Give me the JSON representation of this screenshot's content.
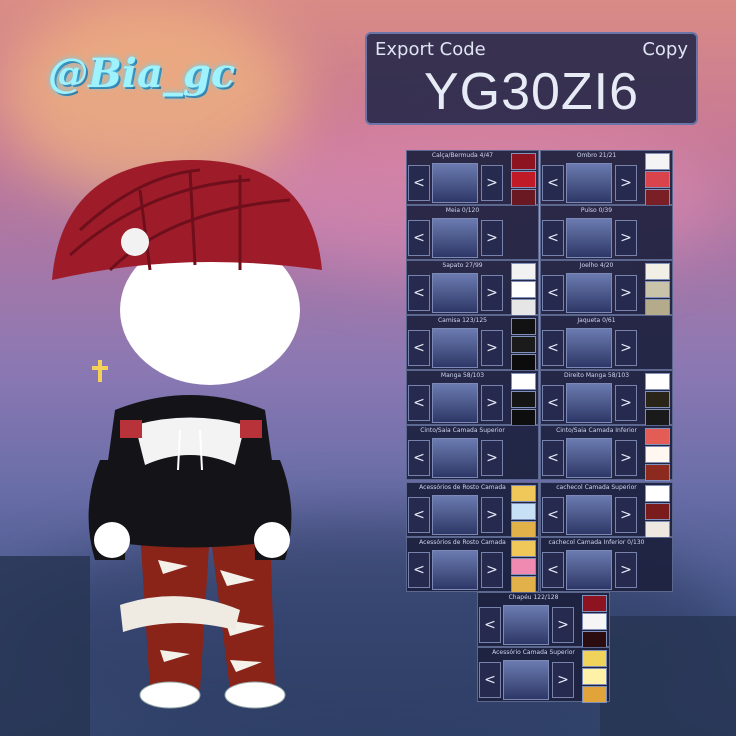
{
  "watermark": "@Bia_gc",
  "export_panel": {
    "title": "Export Code",
    "copy_label": "Copy",
    "code": "YG30ZI6"
  },
  "slots": [
    {
      "label": "Calça/Bermuda 4/47",
      "swatches": [
        "#8d1320",
        "#c01a26",
        "#6a1822"
      ]
    },
    {
      "label": "Ombro 21/21",
      "swatches": [
        "#f4f4f4",
        "#d9434b",
        "#7a1f26"
      ]
    },
    {
      "label": "Meia 0/120",
      "swatches": []
    },
    {
      "label": "Pulso 0/39",
      "swatches": []
    },
    {
      "label": "Sapato 27/99",
      "swatches": [
        "#f2f2f2",
        "#ffffff",
        "#e6e6e6"
      ]
    },
    {
      "label": "Joelho 4/20",
      "swatches": [
        "#f1efe6",
        "#c9c4a9",
        "#b3ab8a"
      ]
    },
    {
      "label": "Camisa 123/125",
      "swatches": [
        "#121212",
        "#1b1b1b",
        "#0c0c0c"
      ]
    },
    {
      "label": "Jaqueta 0/61",
      "swatches": []
    },
    {
      "label": "Manga 58/103",
      "swatches": [
        "#ffffff",
        "#151515",
        "#0e0e0e"
      ]
    },
    {
      "label": "Direito Manga 58/103",
      "swatches": [
        "#ffffff",
        "#2b2418",
        "#1a1a1a"
      ]
    },
    {
      "label": "Cinto/Saia Camada Superior",
      "swatches": []
    },
    {
      "label": "Cinto/Saia Camada Inferior",
      "swatches": [
        "#e35c55",
        "#fff7f0",
        "#8d2a20"
      ]
    },
    {
      "label": "Acessórios de Rosto Camada",
      "swatches": [
        "#f0c85a",
        "#c8e0f6",
        "#e3b14a"
      ]
    },
    {
      "label": "cachecol Camada Superior",
      "swatches": [
        "#ffffff",
        "#7a1c1c",
        "#efe8e0"
      ]
    },
    {
      "label": "Acessórios de Rosto Camada",
      "swatches": [
        "#f0c85a",
        "#f08ab0",
        "#e3b14a"
      ]
    },
    {
      "label": "cachecol Camada Inferior 0/130",
      "swatches": []
    },
    {
      "label": "Chapéu 122/128",
      "swatches": [
        "#8d1320",
        "#f5f5f5",
        "#2b0d10"
      ]
    },
    {
      "label": "Acessório Camada Superior",
      "swatches": [
        "#f0d35a",
        "#fff2a8",
        "#e0a43a"
      ]
    }
  ],
  "colors": {
    "hat": "#9e1c2a",
    "jeans": "#8a2318",
    "hoodie": "#141418",
    "gold": "#f6d15a"
  }
}
